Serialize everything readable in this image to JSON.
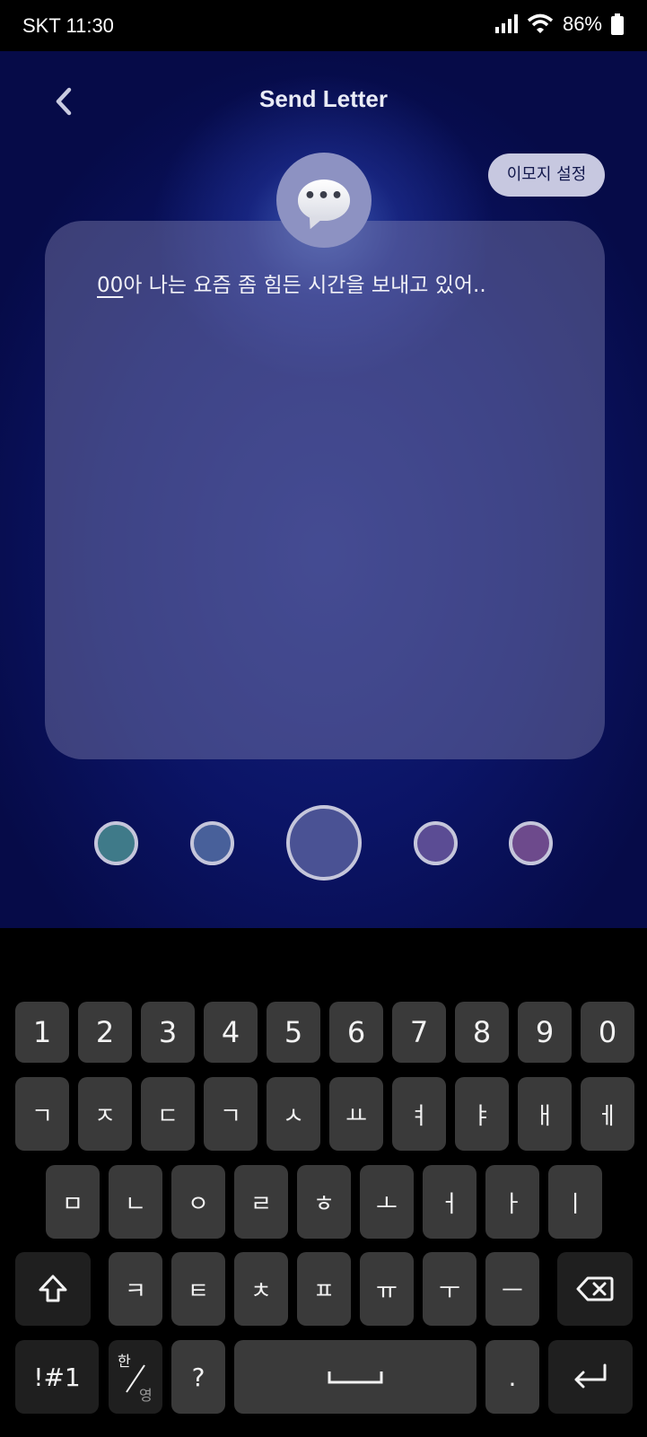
{
  "status_bar": {
    "carrier_time": "SKT 11:30",
    "battery": "86%",
    "icons": [
      "signal-icon",
      "wifi-icon",
      "battery-icon"
    ]
  },
  "header": {
    "title": "Send Letter",
    "back_icon": "chevron-left-icon",
    "emoji_setting_label": "이모지 설정"
  },
  "letter": {
    "emoji_icon": "speech-bubble-icon",
    "bubble_glyph": "•••",
    "name_token": "00",
    "text": "아 나는 요즘 좀 힘든 시간을 보내고 있어.."
  },
  "color_options": [
    {
      "color": "#3f7a89",
      "selected": false
    },
    {
      "color": "#48609a",
      "selected": false
    },
    {
      "color": "#4a5294",
      "selected": true
    },
    {
      "color": "#5b4c94",
      "selected": false
    },
    {
      "color": "#6d4a8c",
      "selected": false
    }
  ],
  "keyboard": {
    "number_row": [
      "1",
      "2",
      "3",
      "4",
      "5",
      "6",
      "7",
      "8",
      "9",
      "0"
    ],
    "row1": [
      "ㄱ",
      "ㅈ",
      "ㄷ",
      "ㄱ",
      "ㅅ",
      "ㅛ",
      "ㅕ",
      "ㅑ",
      "ㅐ",
      "ㅔ"
    ],
    "row2": [
      "ㅁ",
      "ㄴ",
      "ㅇ",
      "ㄹ",
      "ㅎ",
      "ㅗ",
      "ㅓ",
      "ㅏ",
      "ㅣ"
    ],
    "row3": [
      "ㅋ",
      "ㅌ",
      "ㅊ",
      "ㅍ",
      "ㅠ",
      "ㅜ",
      "ㅡ"
    ],
    "symbols_key": "!#1",
    "lang_top": "한",
    "lang_bottom": "영",
    "question_key": "?",
    "period_key": ".",
    "icons": [
      "shift-icon",
      "backspace-icon",
      "space-bar-icon",
      "enter-icon"
    ]
  }
}
